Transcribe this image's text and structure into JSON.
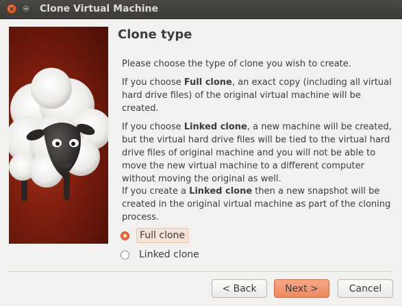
{
  "window": {
    "title": "Clone Virtual Machine"
  },
  "page": {
    "heading": "Clone type",
    "intro": "Please choose the type of clone you wish to create.",
    "full_pre": "If you choose ",
    "full_bold": "Full clone",
    "full_post": ", an exact copy (including all virtual hard drive files) of the original virtual machine will be created.",
    "linked_pre": "If you choose ",
    "linked_bold": "Linked clone",
    "linked_post": ", a new machine will be created, but the virtual hard drive files will be tied to the virtual hard drive files of original machine and you will not be able to move the new virtual machine to a different computer without moving the original as well.",
    "snap_pre": "If you create a ",
    "snap_bold": "Linked clone",
    "snap_post": " then a new snapshot will be created in the original virtual machine as part of the cloning process."
  },
  "options": {
    "full_clone": {
      "label": "Full clone",
      "selected": true
    },
    "linked_clone": {
      "label": "Linked clone",
      "selected": false
    }
  },
  "buttons": {
    "back": "< Back",
    "next": "Next >",
    "cancel": "Cancel"
  },
  "colors": {
    "accent": "#e86f3d",
    "titlebar": "#3c3b37",
    "dialog_bg": "#f2f1f0"
  }
}
